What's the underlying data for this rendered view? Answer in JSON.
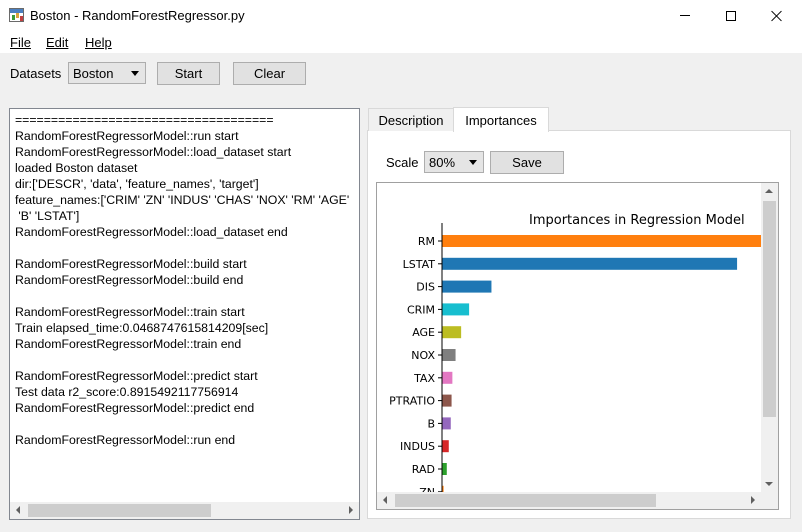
{
  "window": {
    "title": "Boston - RandomForestRegressor.py"
  },
  "menu": {
    "file": "File",
    "edit": "Edit",
    "help": "Help"
  },
  "toolbar": {
    "datasets_label": "Datasets",
    "dataset_selected": "Boston",
    "start_label": "Start",
    "clear_label": "Clear"
  },
  "log": {
    "lines": [
      "====================================",
      "RandomForestRegressorModel::run start",
      "RandomForestRegressorModel::load_dataset start",
      "loaded Boston dataset",
      "dir:['DESCR', 'data', 'feature_names', 'target']",
      "feature_names:['CRIM' 'ZN' 'INDUS' 'CHAS' 'NOX' 'RM' 'AGE'",
      " 'B' 'LSTAT']",
      "RandomForestRegressorModel::load_dataset end",
      "",
      "RandomForestRegressorModel::build start",
      "RandomForestRegressorModel::build end",
      "",
      "RandomForestRegressorModel::train start",
      "Train elapsed_time:0.0468747615814209[sec]",
      "RandomForestRegressorModel::train end",
      "",
      "RandomForestRegressorModel::predict start",
      "Test data r2_score:0.8915492117756914",
      "RandomForestRegressorModel::predict end",
      "",
      "RandomForestRegressorModel::run end"
    ]
  },
  "tabs": {
    "description": "Description",
    "importances": "Importances"
  },
  "importances_panel": {
    "scale_label": "Scale",
    "scale_selected": "80%",
    "save_label": "Save"
  },
  "chart_data": {
    "type": "bar",
    "orientation": "horizontal",
    "title": "Importances in Regression Model",
    "categories": [
      "RM",
      "LSTAT",
      "DIS",
      "CRIM",
      "AGE",
      "NOX",
      "TAX",
      "PTRATIO",
      "B",
      "INDUS",
      "RAD",
      "ZN"
    ],
    "values": [
      0.45,
      0.37,
      0.062,
      0.034,
      0.024,
      0.017,
      0.013,
      0.012,
      0.011,
      0.0085,
      0.006,
      0.002
    ],
    "colors": [
      "#ff7f0e",
      "#1f77b4",
      "#1f77b4",
      "#17becf",
      "#bcbd22",
      "#7f7f7f",
      "#e377c2",
      "#8c564b",
      "#9467bd",
      "#d62728",
      "#2ca02c",
      "#ff7f0e"
    ],
    "xlim": [
      0,
      0.4
    ],
    "xlabel": "",
    "ylabel": "",
    "grid": false,
    "legend": "none"
  }
}
